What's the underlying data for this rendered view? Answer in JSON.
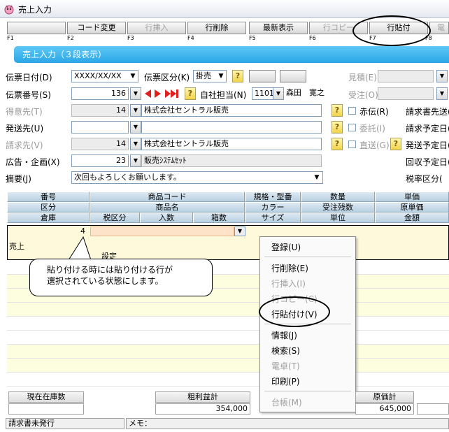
{
  "window": {
    "title": "売上入力"
  },
  "fkeys": [
    {
      "label": "",
      "key": "F1",
      "disabled": false
    },
    {
      "label": "コード変更",
      "key": "F2",
      "disabled": false
    },
    {
      "label": "行挿入",
      "key": "F3",
      "disabled": true
    },
    {
      "label": "行削除",
      "key": "F4",
      "disabled": false
    },
    {
      "label": "最新表示",
      "key": "F5",
      "disabled": false
    },
    {
      "label": "行コピー",
      "key": "F6",
      "disabled": true
    },
    {
      "label": "行貼付",
      "key": "F7",
      "disabled": false
    },
    {
      "label": "電",
      "key": "F8",
      "disabled": true
    }
  ],
  "banner": "売上入力（３段表示）",
  "form": {
    "denpyo_date_label": "伝票日付(D)",
    "denpyo_date_value": "XXXX/XX/XX",
    "denpyo_kubun_label": "伝票区分(K)",
    "denpyo_kubun_value": "掛売",
    "mitsumori_label": "見積(E)",
    "denpyo_no_label": "伝票番号(S)",
    "denpyo_no_value": "136",
    "jisha_tanto_label": "自社担当(N)",
    "jisha_tanto_code": "1101",
    "jisha_tanto_name": "森田　寛之",
    "juchu_label": "受注(O)",
    "tokuisaki_label": "得意先(T)",
    "tokuisaki_code": "14",
    "tokuisaki_name": "株式会社セントラル販売",
    "akaden_label": "赤伝(R)",
    "seikyusho_label": "請求書先送(",
    "hassosaki_label": "発送先(U)",
    "itaku_label": "委託(I)",
    "seikyu_yotei_label": "請求予定日(",
    "seikyusaki_label": "請求先(V)",
    "seikyusaki_code": "14",
    "seikyusaki_name": "株式会社セントラル販売",
    "chokuso_label": "直送(G)",
    "hasso_yotei_label": "発送予定日(",
    "kokoku_label": "広告・企画(X)",
    "kokoku_code": "23",
    "kokoku_name": "販売ｼｽﾃﾑｾｯﾄ",
    "kaishu_label": "回収予定日(",
    "tekiyo_label": "摘要(J)",
    "tekiyo_value": "次回もよろしくお願いします。",
    "zeiritsu_label": "税率区分("
  },
  "grid": {
    "row1": [
      "番号",
      "商品コード",
      "規格・型番",
      "数量",
      "単価"
    ],
    "row2": [
      "区分",
      "商品名",
      "カラー",
      "受注残数",
      "原単価"
    ],
    "row3": [
      "倉庫",
      "税区分",
      "入数",
      "箱数",
      "サイズ",
      "単位",
      "金額"
    ],
    "sel_number": "4",
    "sel_kubun": "売上",
    "sel_partial": "設定"
  },
  "context_menu": [
    {
      "label": "登録(U)",
      "disabled": false
    },
    {
      "label": "行削除(E)",
      "disabled": false
    },
    {
      "label": "行挿入(I)",
      "disabled": true
    },
    {
      "label": "行コピー(C)",
      "disabled": true
    },
    {
      "label": "行貼付け(V)",
      "disabled": false
    },
    {
      "label": "情報(J)",
      "disabled": false
    },
    {
      "label": "検索(S)",
      "disabled": false
    },
    {
      "label": "電卓(T)",
      "disabled": true
    },
    {
      "label": "印刷(P)",
      "disabled": false
    },
    {
      "label": "台帳(M)",
      "disabled": true
    }
  ],
  "callout": {
    "line1": "貼り付ける時には貼り付ける行が",
    "line2": "選択されている状態にします。"
  },
  "footer": {
    "zaiko_label": "現在在庫数",
    "arari_label": "粗利益計",
    "arari_value": "354,000",
    "genka_label": "原価計",
    "genka_value": "645,000"
  },
  "status": {
    "seikyu": "請求書未発行",
    "memo": "メモ："
  }
}
